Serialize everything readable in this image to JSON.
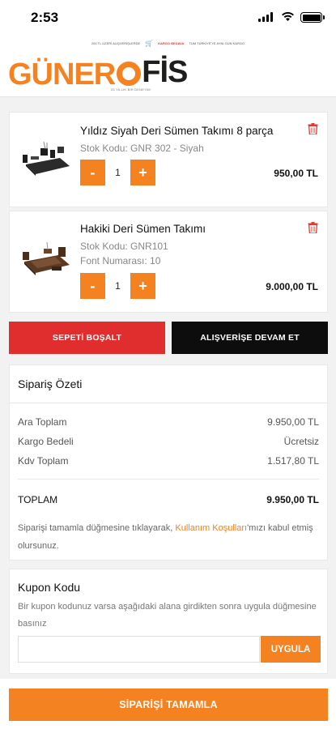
{
  "status_bar": {
    "time": "2:53"
  },
  "promo_bar": {
    "left_text": "200 TL ÜZERİ ALIŞVERİŞLERDE",
    "highlight": "KARGO BEDAVA",
    "right_text": "TÜM TÜRKİYE'YE AYNI GÜN KARGO"
  },
  "header": {
    "logo_left": "GÜNER",
    "logo_right": "FİS",
    "tagline": "25 YILLIK BİR DENEYİM"
  },
  "cart": {
    "items": [
      {
        "name": "Yıldız Siyah Deri Sümen Takımı 8 parça",
        "sku": "Stok Kodu: GNR 302 - Siyah",
        "font_number": "",
        "minus": "-",
        "qty": "1",
        "plus": "+",
        "price": "950,00 TL",
        "icon": "trash-icon"
      },
      {
        "name": "Hakiki Deri Sümen Takımı",
        "sku": "Stok Kodu: GNR101",
        "font_number": "Font Numarası: 10",
        "minus": "-",
        "qty": "1",
        "plus": "+",
        "price": "9.000,00 TL",
        "icon": "trash-icon"
      }
    ]
  },
  "actions": {
    "empty_cart": "SEPETİ BOŞALT",
    "continue_shopping": "ALIŞVERİŞE DEVAM ET"
  },
  "summary": {
    "title": "Sipariş Özeti",
    "subtotal_label": "Ara Toplam",
    "subtotal_value": "9.950,00 TL",
    "shipping_label": "Kargo Bedeli",
    "shipping_value": "Ücretsiz",
    "tax_label": "Kdv Toplam",
    "tax_value": "1.517,80 TL",
    "total_label": "TOPLAM",
    "total_value": "9.950,00 TL",
    "terms_prefix": "Siparişi tamamla düğmesine tıklayarak,",
    "terms_link": "Kullanım Koşulları",
    "terms_suffix": "'mızı kabul etmiş olursunuz."
  },
  "coupon": {
    "title": "Kupon Kodu",
    "description": "Bir kupon kodunuz varsa aşağıdaki alana girdikten sonra uygula düğmesine basınız",
    "input_value": "",
    "placeholder": "",
    "apply_label": "UYGULA"
  },
  "footer": {
    "complete_label": "SİPARİŞİ TAMAMLA"
  },
  "colors": {
    "brand": "#f58220",
    "danger": "#e02e2e",
    "dark": "#0d0d0d"
  }
}
